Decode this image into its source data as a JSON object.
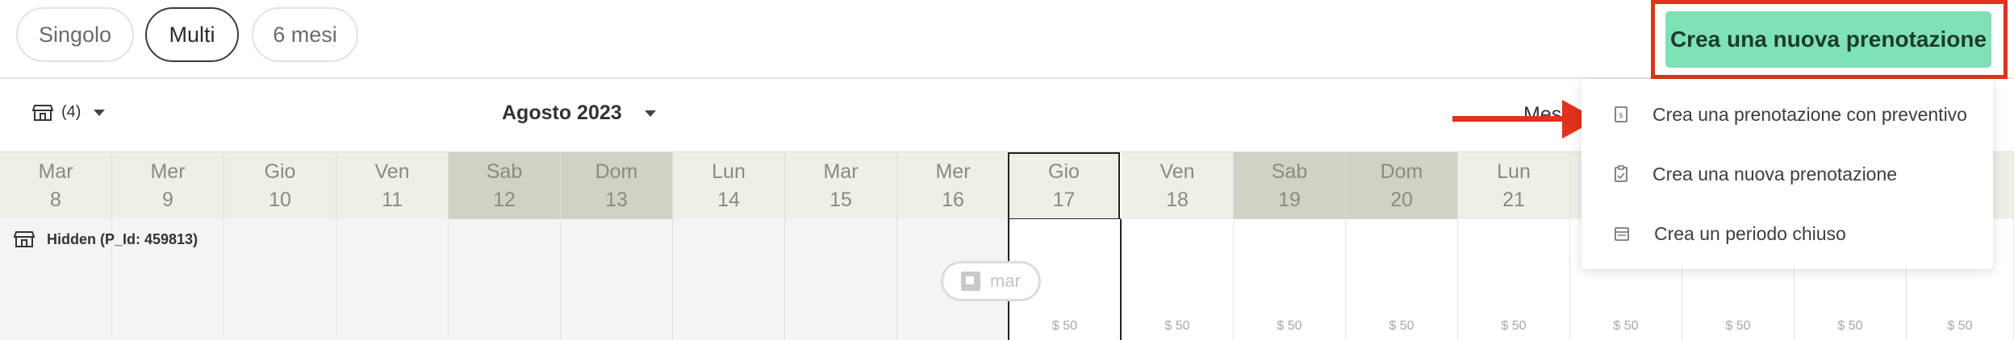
{
  "view_toggle": {
    "options": [
      "Singolo",
      "Multi",
      "6 mesi"
    ],
    "active": "Multi"
  },
  "cta": {
    "label": "Crea una nuova prenotazione",
    "highlight_color": "#e0321c",
    "bg_color": "#7fe2b6"
  },
  "toolbar": {
    "store_count": "(4)",
    "month_label": "Agosto 2023",
    "view_label": "Mes"
  },
  "days": [
    {
      "name": "Mar",
      "num": "8"
    },
    {
      "name": "Mer",
      "num": "9"
    },
    {
      "name": "Gio",
      "num": "10"
    },
    {
      "name": "Ven",
      "num": "11"
    },
    {
      "name": "Sab",
      "num": "12"
    },
    {
      "name": "Dom",
      "num": "13"
    },
    {
      "name": "Lun",
      "num": "14"
    },
    {
      "name": "Mar",
      "num": "15"
    },
    {
      "name": "Mer",
      "num": "16"
    },
    {
      "name": "Gio",
      "num": "17"
    },
    {
      "name": "Ven",
      "num": "18"
    },
    {
      "name": "Sab",
      "num": "19"
    },
    {
      "name": "Dom",
      "num": "20"
    },
    {
      "name": "Lun",
      "num": "21"
    }
  ],
  "property": {
    "label": "Hidden (P_Id: 459813)",
    "price": "$ 50",
    "pill_text": "mar"
  },
  "dropdown": {
    "items": [
      {
        "label": "Crea una prenotazione con preventivo",
        "icon": "quote-doc-icon"
      },
      {
        "label": "Crea una nuova prenotazione",
        "icon": "clipboard-icon"
      },
      {
        "label": "Crea un periodo chiuso",
        "icon": "calendar-icon"
      }
    ]
  }
}
